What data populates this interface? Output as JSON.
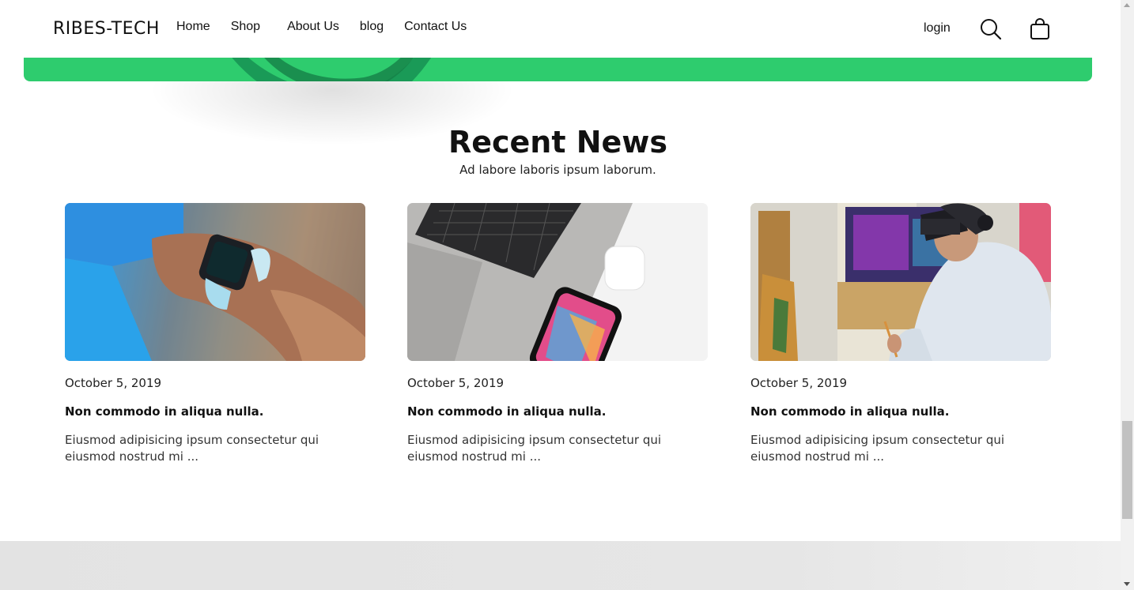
{
  "header": {
    "brand": "RIBES-TECH",
    "nav": [
      "Home",
      "Shop",
      "About Us",
      "blog",
      "Contact Us"
    ],
    "login": "login",
    "icons": [
      "search-icon",
      "shopping-bag-icon"
    ]
  },
  "colors": {
    "banner": "#2ecc6e",
    "band": "#1e9b55",
    "footer": "#e4e4e4"
  },
  "section": {
    "title": "Recent News",
    "subtitle": "Ad labore laboris ipsum laborum."
  },
  "posts": [
    {
      "image": "smartwatch-on-wrist",
      "date": "October 5, 2019",
      "title": "Non commodo in aliqua nulla.",
      "excerpt": "Eiusmod adipisicing ipsum consectetur qui eiusmod nostrud mi ..."
    },
    {
      "image": "laptop-phone-earbuds",
      "date": "October 5, 2019",
      "title": "Non commodo in aliqua nulla.",
      "excerpt": "Eiusmod adipisicing ipsum consectetur qui eiusmod nostrud mi ..."
    },
    {
      "image": "vr-headset-painter",
      "date": "October 5, 2019",
      "title": "Non commodo in aliqua nulla.",
      "excerpt": "Eiusmod adipisicing ipsum consectetur qui eiusmod nostrud mi ..."
    }
  ]
}
